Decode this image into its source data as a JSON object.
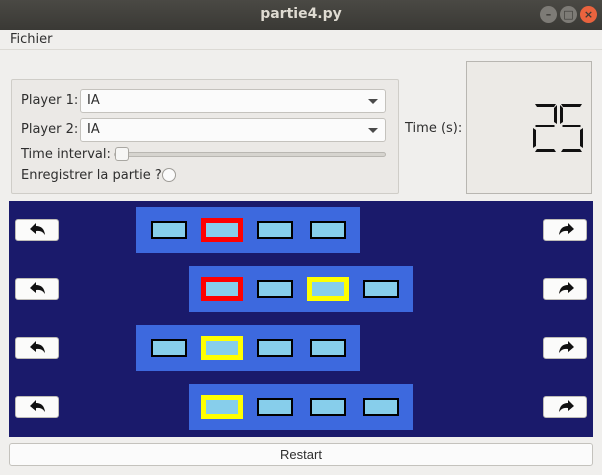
{
  "window": {
    "title": "partie4.py"
  },
  "menu": {
    "file": "Fichier"
  },
  "settings": {
    "player1_label": "Player 1:",
    "player1_value": "IA",
    "player2_label": "Player 2:",
    "player2_value": "IA",
    "interval_label": "Time interval:",
    "interval_value": 0,
    "record_label": "Enregistrer la partie ?",
    "record_checked": false
  },
  "timer": {
    "label": "Time (s):",
    "value": "25"
  },
  "board": {
    "rows": [
      {
        "offset": 0,
        "cells": [
          "plain",
          "red",
          "plain",
          "plain"
        ]
      },
      {
        "offset": 1,
        "cells": [
          "red",
          "plain",
          "yellow",
          "plain"
        ]
      },
      {
        "offset": 0,
        "cells": [
          "plain",
          "yellow",
          "plain",
          "plain"
        ]
      },
      {
        "offset": 1,
        "cells": [
          "yellow",
          "plain",
          "plain",
          "plain"
        ]
      }
    ],
    "left_icon": "undo-arrow-icon",
    "right_icon": "redo-arrow-icon"
  },
  "restart_label": "Restart",
  "colors": {
    "board_bg": "#1a1a6b",
    "row_bg": "#3d69de",
    "cell": "#87ceeb",
    "red": "#ff0000",
    "yellow": "#ffff00"
  }
}
